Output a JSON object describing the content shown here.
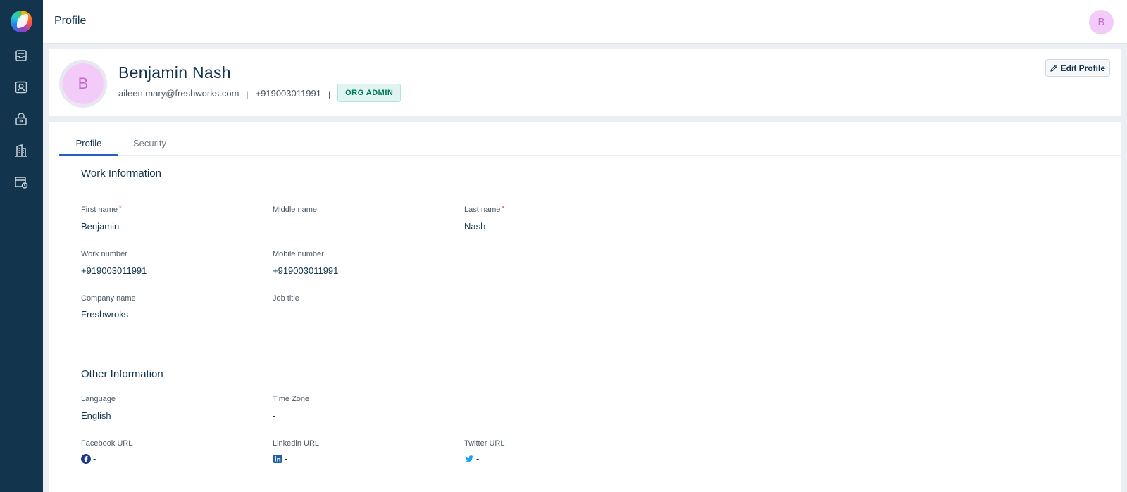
{
  "topbar": {
    "title": "Profile",
    "avatar_initial": "B"
  },
  "sidebar": {
    "items": [
      {
        "icon": "inbox-icon"
      },
      {
        "icon": "contact-icon"
      },
      {
        "icon": "lock-icon"
      },
      {
        "icon": "building-icon"
      },
      {
        "icon": "audit-log-icon"
      }
    ]
  },
  "user": {
    "initial": "B",
    "name": "Benjamin Nash",
    "email": "aileen.mary@freshworks.com",
    "phone": "+919003011991",
    "separator": "|",
    "role": "ORG ADMIN"
  },
  "actions": {
    "edit_label": "Edit Profile"
  },
  "tabs": {
    "profile": "Profile",
    "security": "Security"
  },
  "work": {
    "title": "Work Information",
    "required_mark": "*",
    "first_name_label": "First name",
    "first_name": "Benjamin",
    "middle_name_label": "Middle name",
    "middle_name": "-",
    "last_name_label": "Last name",
    "last_name": "Nash",
    "work_number_label": "Work number",
    "work_number": "+919003011991",
    "mobile_number_label": "Mobile number",
    "mobile_number": "+919003011991",
    "company_label": "Company name",
    "company": "Freshwroks",
    "job_title_label": "Job title",
    "job_title": "-"
  },
  "other": {
    "title": "Other Information",
    "language_label": "Language",
    "language": "English",
    "timezone_label": "Time Zone",
    "timezone": "-",
    "facebook_label": "Facebook URL",
    "facebook": "-",
    "linkedin_label": "Linkedin URL",
    "linkedin": "-",
    "twitter_label": "Twitter URL",
    "twitter": "-"
  },
  "colors": {
    "sidebar": "#12344d",
    "accent": "#2c5cc5",
    "avatar_bg": "#f3cbf9",
    "badge_bg": "#e0f5f1"
  }
}
